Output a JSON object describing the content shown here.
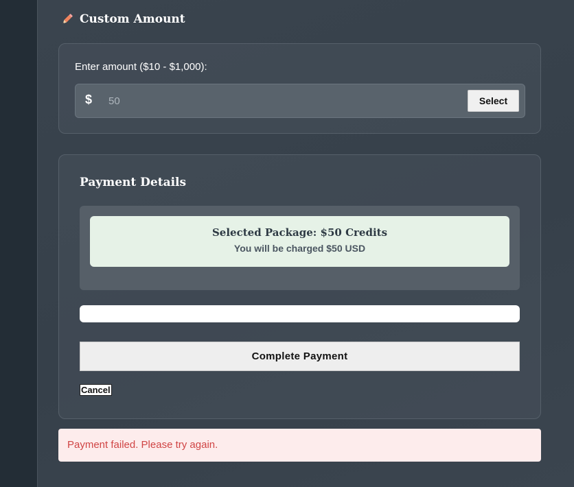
{
  "custom_amount": {
    "title": "Custom Amount",
    "icon": "pencil-icon",
    "label": "Enter amount ($10 - $1,000):",
    "currency_symbol": "$",
    "placeholder": "50",
    "select_label": "Select"
  },
  "payment_details": {
    "title": "Payment Details",
    "summary_title": "Selected Package: $50 Credits",
    "summary_subtitle": "You will be charged $50 USD",
    "complete_label": "Complete Payment",
    "cancel_label": "Cancel"
  },
  "error": {
    "message": "Payment failed. Please try again."
  },
  "colors": {
    "background": "#232d36",
    "panel": "#3a444e",
    "accent_pencil": "#f0845e",
    "summary_bg": "#e6f2e7",
    "error_bg": "#fdecec",
    "error_text": "#d04444"
  }
}
